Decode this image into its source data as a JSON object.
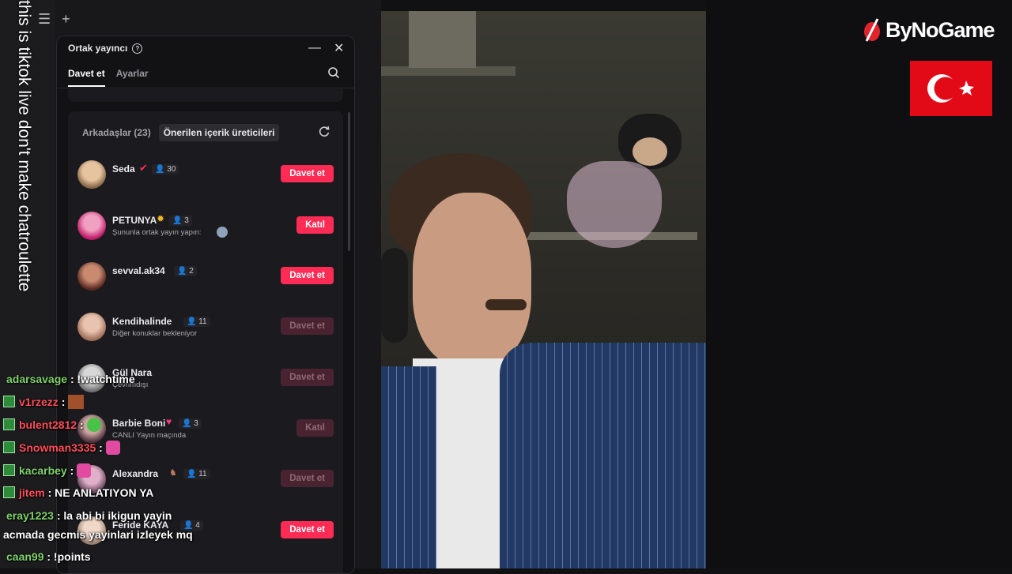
{
  "panel": {
    "title": "Ortak yayıncı",
    "tabs": [
      {
        "label": "Davet et",
        "active": true
      },
      {
        "label": "Ayarlar",
        "active": false
      }
    ],
    "subtabs": [
      {
        "label": "Arkadaşlar (23)",
        "active": false
      },
      {
        "label": "Önerilen içerik üreticileri",
        "active": true
      }
    ],
    "users": [
      {
        "name": "Seda",
        "count": "30",
        "sub": "",
        "action": "Davet et",
        "enabled": true
      },
      {
        "name": "PETUNYA",
        "count": "3",
        "sub": "Şununla ortak yayın yapın:",
        "action": "Katıl",
        "enabled": true
      },
      {
        "name": "sevval.ak34",
        "count": "2",
        "sub": "",
        "action": "Davet et",
        "enabled": true
      },
      {
        "name": "Kendihalinde",
        "count": "11",
        "sub": "Diğer konuklar bekleniyor",
        "action": "Davet et",
        "enabled": false
      },
      {
        "name": "Gül Nara",
        "count": "",
        "sub": "Çevrimdışı",
        "action": "Davet et",
        "enabled": false
      },
      {
        "name": "Barbie Boni",
        "count": "3",
        "sub": "CANLI Yayın maçında",
        "action": "Katıl",
        "enabled": false
      },
      {
        "name": "Alexandra",
        "count": "11",
        "sub": "",
        "action": "Davet et",
        "enabled": false
      },
      {
        "name": "Feride KAYA",
        "count": "4",
        "sub": "",
        "action": "Davet et",
        "enabled": true
      }
    ]
  },
  "chat": [
    {
      "user": "adarsavage",
      "text": ": !watchtime",
      "color": "#7fd36b",
      "badge": false
    },
    {
      "user": "v1rzezz",
      "text": ":",
      "color": "#ff4d5a",
      "badge": true
    },
    {
      "user": "bulent2812",
      "text": ":",
      "color": "#ff4d5a",
      "badge": true
    },
    {
      "user": "Snowman3335",
      "text": ":",
      "color": "#ff4d5a",
      "badge": true
    },
    {
      "user": "kacarbey",
      "text": ":",
      "color": "#7fd36b",
      "badge": true
    },
    {
      "user": "jitem",
      "text": ": NE ANLATIYON YA",
      "color": "#ff4d5a",
      "badge": true
    },
    {
      "user": "eray1223",
      "text": ": la abi bi ikigun yayin",
      "color": "#7fd36b",
      "badge": false
    },
    {
      "user": "",
      "text": "acmada gecmis yayinlari izleyek mq",
      "color": "#ffffff",
      "badge": false
    },
    {
      "user": "caan99",
      "text": ": !points",
      "color": "#7fd36b",
      "badge": false
    }
  ],
  "overlay_text": "this is tiktok live don't make chatroulette",
  "brand": "ByNoGame",
  "colors": {
    "accent": "#fe2c55",
    "panel_bg": "#121214",
    "flag_red": "#e30a17"
  }
}
